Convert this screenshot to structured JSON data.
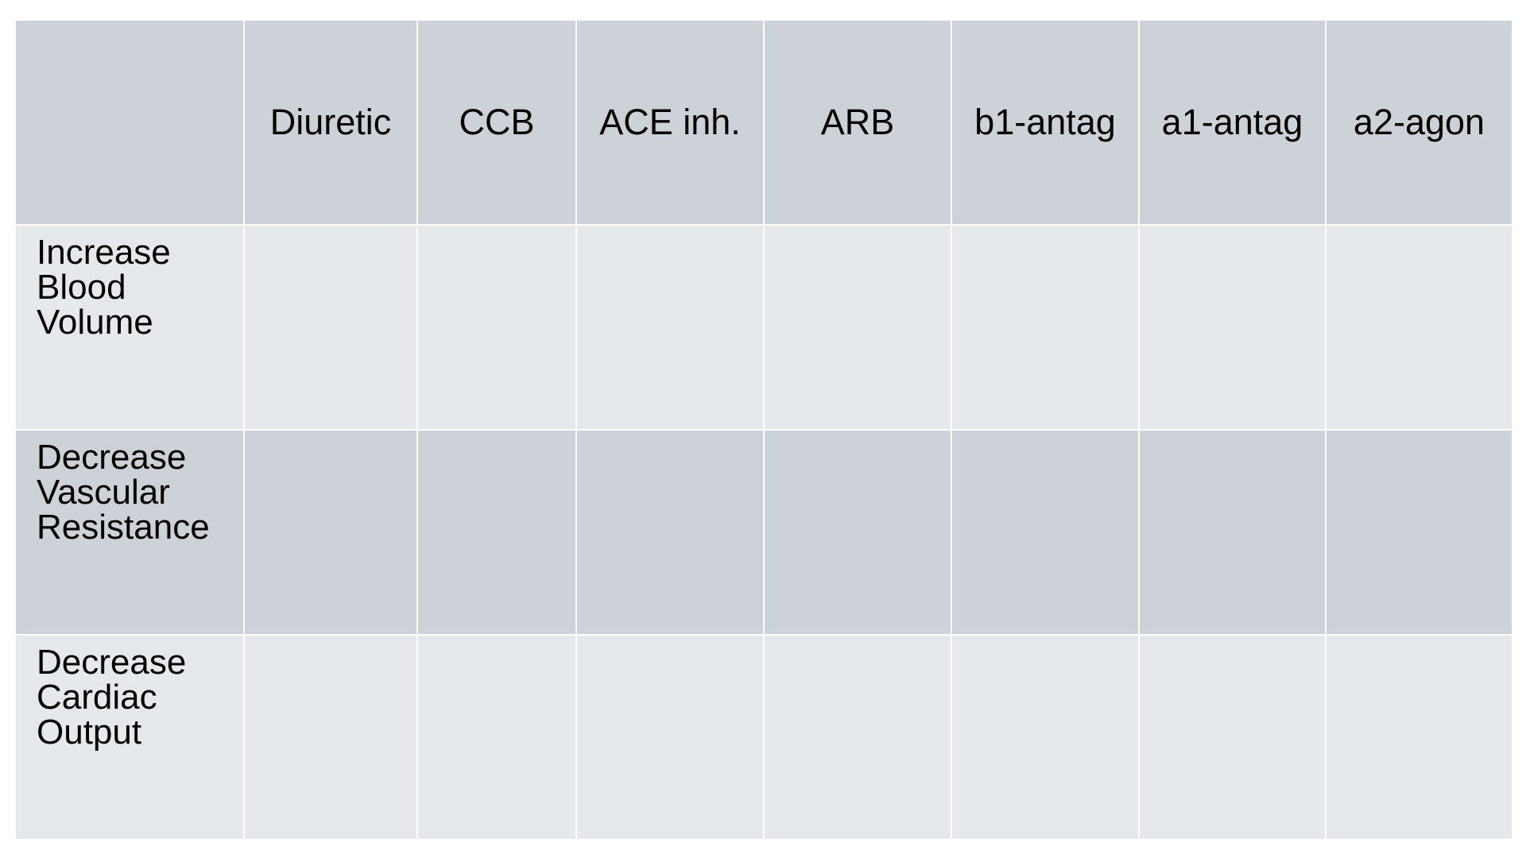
{
  "table": {
    "corner": "",
    "columns": [
      "Diuretic",
      "CCB",
      "ACE inh.",
      "ARB",
      "b1-antag",
      "a1-antag",
      "a2-agon"
    ],
    "rows": [
      {
        "label_lines": [
          "Increase",
          "Blood",
          "Volume"
        ],
        "cells": [
          "",
          "",
          "",
          "",
          "",
          "",
          ""
        ]
      },
      {
        "label_lines": [
          "Decrease",
          "Vascular",
          "Resistance"
        ],
        "cells": [
          "",
          "",
          "",
          "",
          "",
          "",
          ""
        ]
      },
      {
        "label_lines": [
          "Decrease",
          "Cardiac",
          "Output"
        ],
        "cells": [
          "",
          "",
          "",
          "",
          "",
          "",
          ""
        ]
      }
    ]
  },
  "colors": {
    "header_fill": "#cdd1d8",
    "band_light": "#e6e9ec",
    "band_dark": "#cdd1d8",
    "grid_line": "#ffffff",
    "text": "#000000"
  }
}
